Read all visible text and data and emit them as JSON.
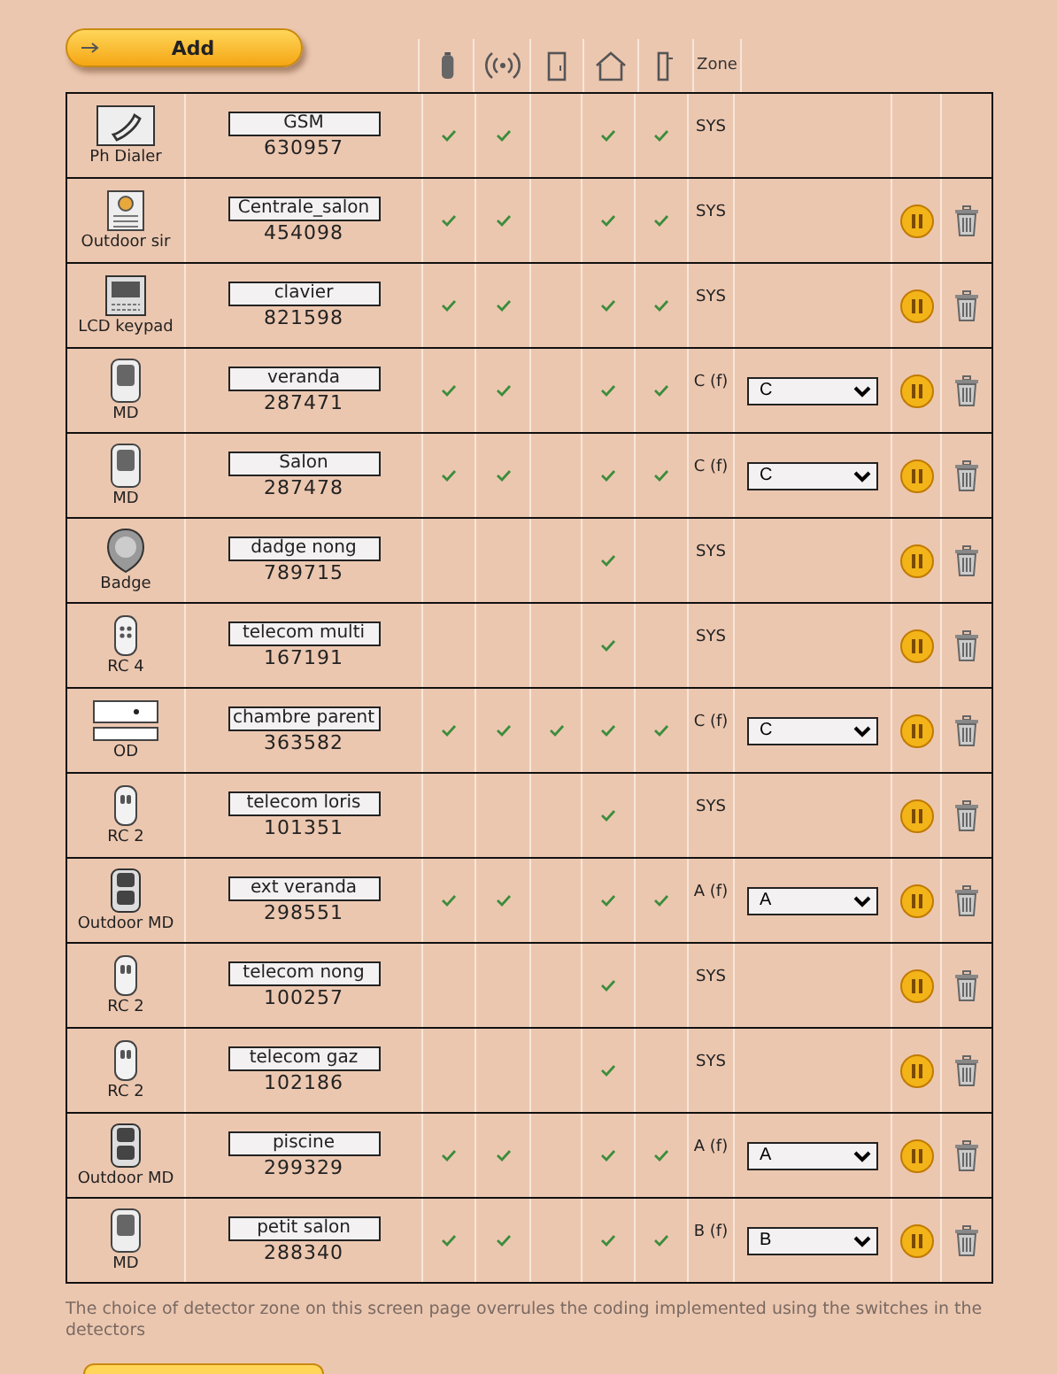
{
  "add_button": {
    "label": "Add"
  },
  "header": {
    "zone": "Zone"
  },
  "devices": [
    {
      "kind": "dialer",
      "type": "Ph Dialer",
      "name": "GSM",
      "code": "630957",
      "checks": [
        true,
        true,
        false,
        true,
        true
      ],
      "zone": "SYS",
      "removable": false
    },
    {
      "kind": "siren",
      "type": "Outdoor sir",
      "name": "Centrale_salon",
      "code": "454098",
      "checks": [
        true,
        true,
        false,
        true,
        true
      ],
      "zone": "SYS",
      "removable": true
    },
    {
      "kind": "keypad",
      "type": "LCD keypad",
      "name": "clavier",
      "code": "821598",
      "checks": [
        true,
        true,
        false,
        true,
        true
      ],
      "zone": "SYS",
      "removable": true
    },
    {
      "kind": "md",
      "type": "MD",
      "name": "veranda",
      "code": "287471",
      "checks": [
        true,
        true,
        false,
        true,
        true
      ],
      "zone": "C (f)",
      "select": "C",
      "removable": true
    },
    {
      "kind": "md",
      "type": "MD",
      "name": "Salon",
      "code": "287478",
      "checks": [
        true,
        true,
        false,
        true,
        true
      ],
      "zone": "C (f)",
      "select": "C",
      "removable": true
    },
    {
      "kind": "badge",
      "type": "Badge",
      "name": "dadge nong",
      "code": "789715",
      "checks": [
        false,
        false,
        false,
        true,
        false
      ],
      "zone": "SYS",
      "removable": true
    },
    {
      "kind": "rc4",
      "type": "RC 4",
      "name": "telecom multi",
      "code": "167191",
      "checks": [
        false,
        false,
        false,
        true,
        false
      ],
      "zone": "SYS",
      "removable": true
    },
    {
      "kind": "od",
      "type": "OD",
      "name": "chambre parent",
      "code": "363582",
      "checks": [
        true,
        true,
        true,
        true,
        true
      ],
      "zone": "C (f)",
      "select": "C",
      "removable": true
    },
    {
      "kind": "rc2",
      "type": "RC 2",
      "name": "telecom loris",
      "code": "101351",
      "checks": [
        false,
        false,
        false,
        true,
        false
      ],
      "zone": "SYS",
      "removable": true
    },
    {
      "kind": "outdoor_md",
      "type": "Outdoor MD",
      "name": "ext veranda",
      "code": "298551",
      "checks": [
        true,
        true,
        false,
        true,
        true
      ],
      "zone": "A (f)",
      "select": "A",
      "removable": true
    },
    {
      "kind": "rc2",
      "type": "RC 2",
      "name": "telecom nong",
      "code": "100257",
      "checks": [
        false,
        false,
        false,
        true,
        false
      ],
      "zone": "SYS",
      "removable": true
    },
    {
      "kind": "rc2",
      "type": "RC 2",
      "name": "telecom gaz",
      "code": "102186",
      "checks": [
        false,
        false,
        false,
        true,
        false
      ],
      "zone": "SYS",
      "removable": true
    },
    {
      "kind": "outdoor_md",
      "type": "Outdoor MD",
      "name": "piscine",
      "code": "299329",
      "checks": [
        true,
        true,
        false,
        true,
        true
      ],
      "zone": "A (f)",
      "select": "A",
      "removable": true
    },
    {
      "kind": "md",
      "type": "MD",
      "name": "petit salon",
      "code": "288340",
      "checks": [
        true,
        true,
        false,
        true,
        true
      ],
      "zone": "B (f)",
      "select": "B",
      "removable": true
    }
  ],
  "note": "The choice of detector zone on this screen page overrules the coding implemented using the switches in the detectors"
}
